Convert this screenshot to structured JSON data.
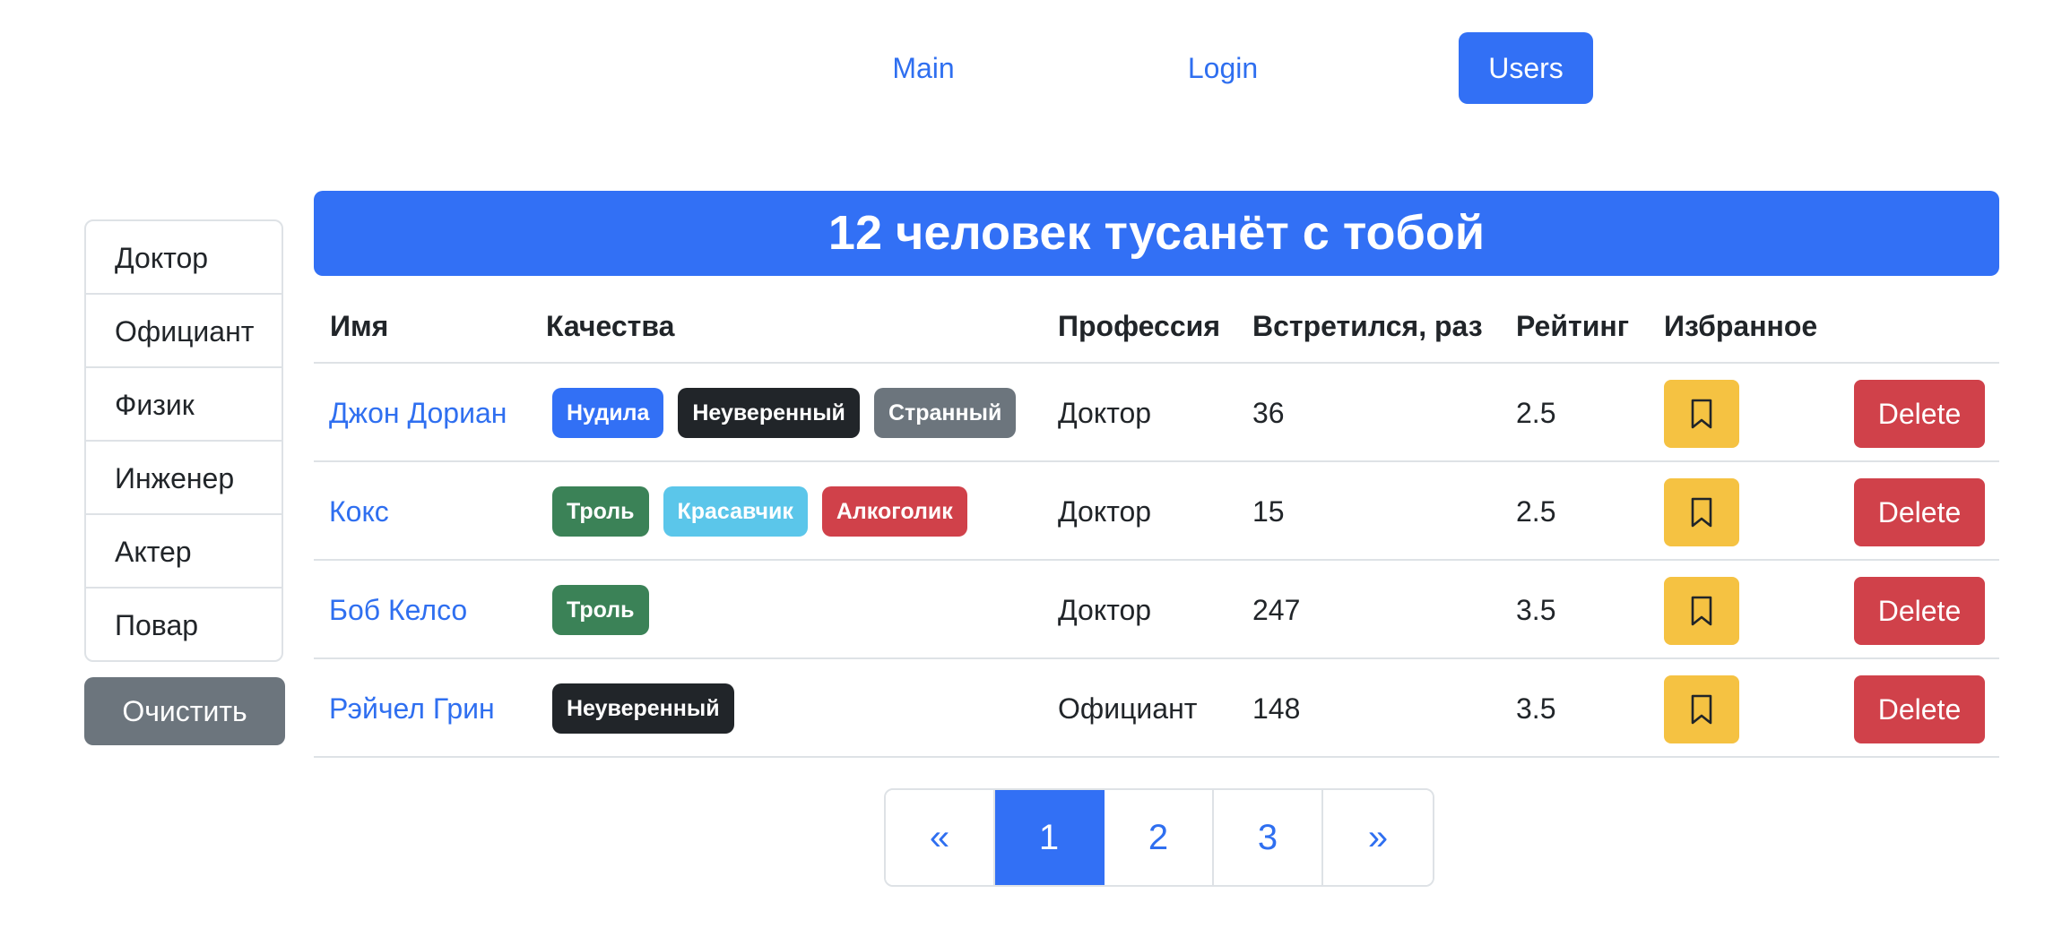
{
  "nav": {
    "links": [
      {
        "label": "Main",
        "active": false
      },
      {
        "label": "Login",
        "active": false
      },
      {
        "label": "Users",
        "active": true
      }
    ]
  },
  "sidebar": {
    "items": [
      {
        "label": "Доктор"
      },
      {
        "label": "Официант"
      },
      {
        "label": "Физик"
      },
      {
        "label": "Инженер"
      },
      {
        "label": "Актер"
      },
      {
        "label": "Повар"
      }
    ],
    "clear_label": "Очистить"
  },
  "banner": {
    "title": "12 человек тусанёт с тобой"
  },
  "table": {
    "columns": [
      "Имя",
      "Качества",
      "Профессия",
      "Встретился, раз",
      "Рейтинг",
      "Избранное"
    ],
    "rows": [
      {
        "name": "Джон Дориан",
        "qualities": [
          {
            "label": "Нудила",
            "color": "#3270f5"
          },
          {
            "label": "Неуверенный",
            "color": "#212529"
          },
          {
            "label": "Странный",
            "color": "#6c757d"
          }
        ],
        "profession": "Доктор",
        "met": "36",
        "rating": "2.5",
        "delete_label": "Delete"
      },
      {
        "name": "Кокс",
        "qualities": [
          {
            "label": "Троль",
            "color": "#3b8257"
          },
          {
            "label": "Красавчик",
            "color": "#5bc6ea"
          },
          {
            "label": "Алкоголик",
            "color": "#d0414a"
          }
        ],
        "profession": "Доктор",
        "met": "15",
        "rating": "2.5",
        "delete_label": "Delete"
      },
      {
        "name": "Боб Келсо",
        "qualities": [
          {
            "label": "Троль",
            "color": "#3b8257"
          }
        ],
        "profession": "Доктор",
        "met": "247",
        "rating": "3.5",
        "delete_label": "Delete"
      },
      {
        "name": "Рэйчел Грин",
        "qualities": [
          {
            "label": "Неуверенный",
            "color": "#212529"
          }
        ],
        "profession": "Официант",
        "met": "148",
        "rating": "3.5",
        "delete_label": "Delete"
      }
    ]
  },
  "pagination": {
    "prev": "«",
    "pages": [
      "1",
      "2",
      "3"
    ],
    "current": "1",
    "next": "»"
  },
  "colors": {
    "primary": "#3270f5",
    "warning": "#f5c242",
    "danger": "#d0414a",
    "secondary": "#6c757d"
  }
}
